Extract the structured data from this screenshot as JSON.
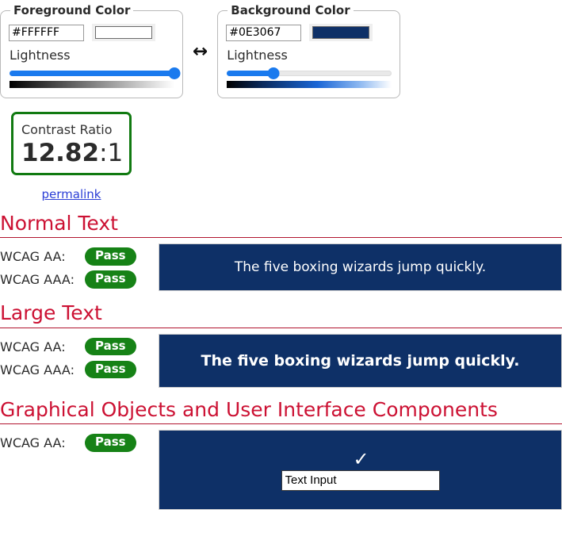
{
  "foreground": {
    "legend": "Foreground Color",
    "hex_value": "#FFFFFF",
    "hex_placeholder": "#FFFFFF",
    "swatch_color": "#FFFFFF",
    "lightness_label": "Lightness",
    "lightness_percent": 100,
    "gradient": "linear-gradient(to right, #000000 0%, #ffffff 100%)"
  },
  "swap": {
    "icon": "swap-horizontal-icon",
    "glyph": "↔"
  },
  "background": {
    "legend": "Background Color",
    "hex_value": "#0E3067",
    "hex_placeholder": "#0E3067",
    "swatch_color": "#0E3067",
    "lightness_label": "Lightness",
    "lightness_percent": 28,
    "gradient": "linear-gradient(to right, #000000 0%, #0b2b5e 22%, #1a66d6 55%, #8ab6f0 80%, #ffffff 100%)"
  },
  "contrast": {
    "title": "Contrast Ratio",
    "value": "12.82",
    "suffix": ":1",
    "border_color": "#117a11",
    "permalink_label": "permalink"
  },
  "sections": [
    {
      "heading": "Normal Text",
      "checks": [
        {
          "label": "WCAG AA:",
          "result": "Pass"
        },
        {
          "label": "WCAG AAA:",
          "result": "Pass"
        }
      ],
      "sample_text": "The five boxing wizards jump quickly."
    },
    {
      "heading": "Large Text",
      "checks": [
        {
          "label": "WCAG AA:",
          "result": "Pass"
        },
        {
          "label": "WCAG AAA:",
          "result": "Pass"
        }
      ],
      "sample_text": "The five boxing wizards jump quickly."
    },
    {
      "heading": "Graphical Objects and User Interface Components",
      "checks": [
        {
          "label": "WCAG AA:",
          "result": "Pass"
        }
      ],
      "checkmark_glyph": "✓",
      "text_input_value": "Text Input"
    }
  ],
  "colors": {
    "heading": "#cc1133",
    "rule": "#b1152f",
    "pass_badge": "#168216",
    "link": "#2b3ed6",
    "sample_bg": "#0E3067",
    "sample_fg": "#FFFFFF",
    "slider_accent": "#1a7aee"
  }
}
